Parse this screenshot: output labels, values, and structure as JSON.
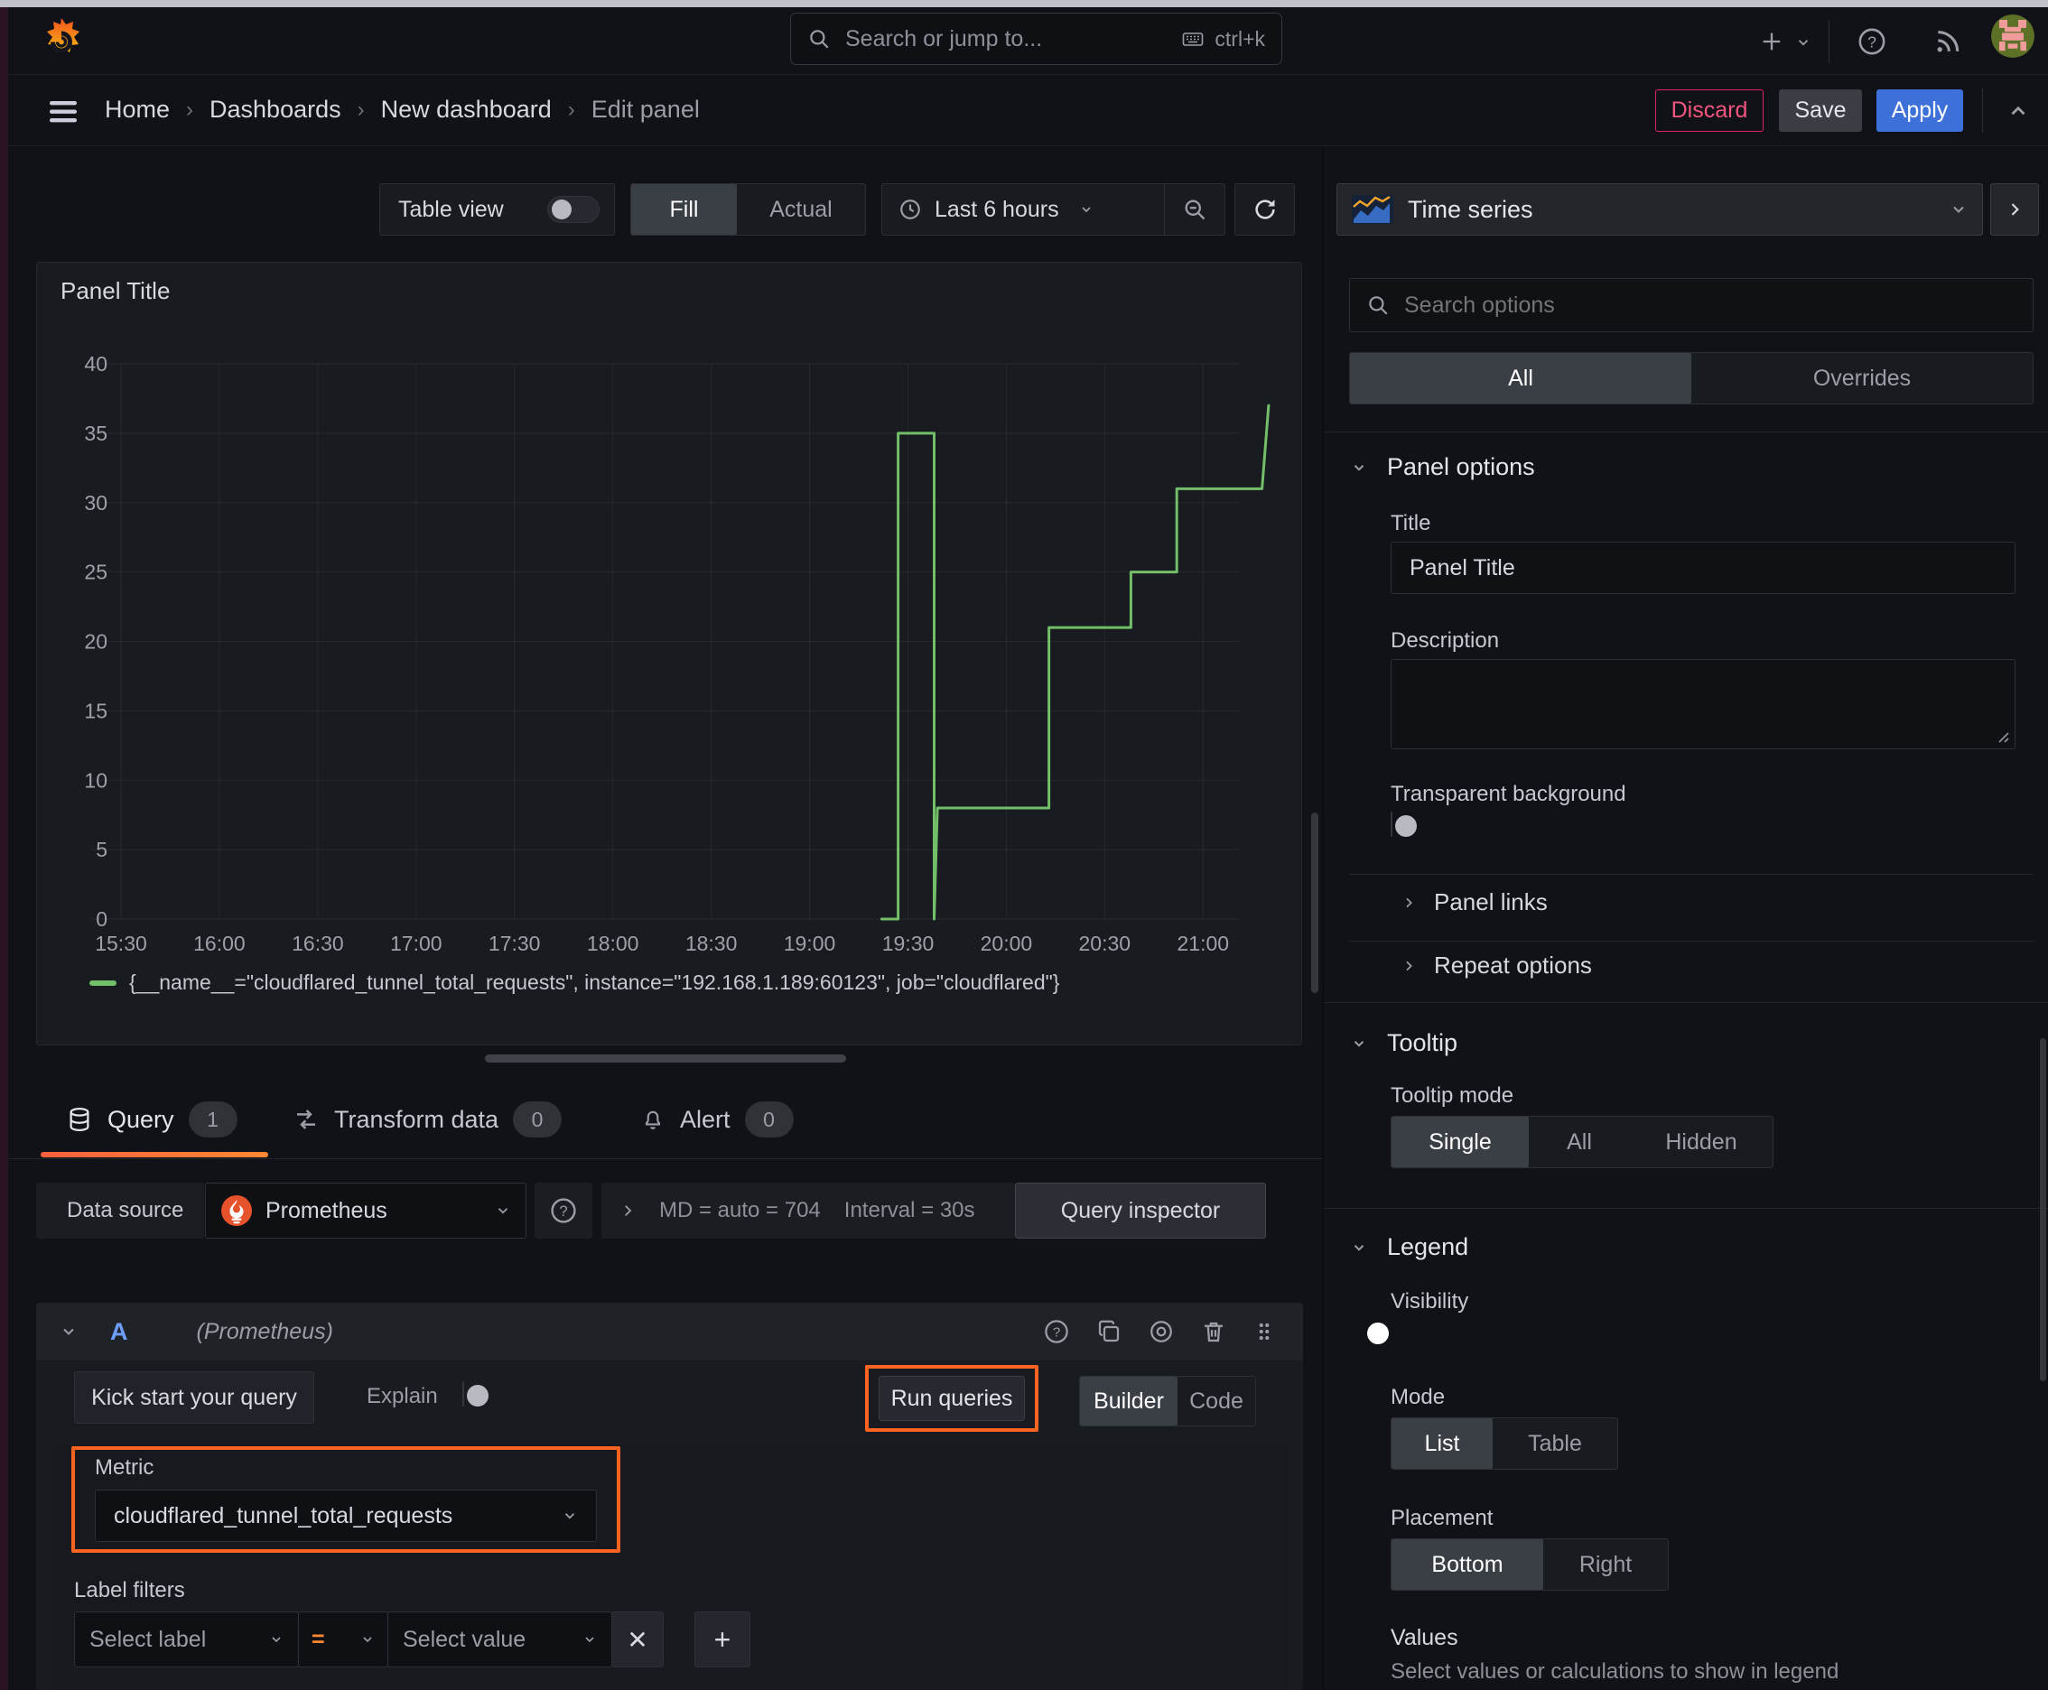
{
  "topbar": {
    "search_placeholder": "Search or jump to...",
    "shortcut_label": "ctrl+k"
  },
  "breadcrumb": {
    "items": [
      "Home",
      "Dashboards",
      "New dashboard",
      "Edit panel"
    ]
  },
  "header_actions": {
    "discard": "Discard",
    "save": "Save",
    "apply": "Apply"
  },
  "panel_toolbar": {
    "table_view_label": "Table view",
    "fill_label": "Fill",
    "actual_label": "Actual",
    "time_range_label": "Last 6 hours"
  },
  "viz_picker_label": "Time series",
  "panel": {
    "title": "Panel Title"
  },
  "chart_data": {
    "type": "line",
    "title": "Panel Title",
    "x_tick_labels": [
      "15:30",
      "16:00",
      "16:30",
      "17:00",
      "17:30",
      "18:00",
      "18:30",
      "19:00",
      "19:30",
      "20:00",
      "20:30",
      "21:00"
    ],
    "x_tick_minutes": [
      0,
      30,
      60,
      90,
      120,
      150,
      180,
      210,
      240,
      270,
      300,
      330
    ],
    "x_range_minutes": [
      0,
      352
    ],
    "y_ticks": [
      0,
      5,
      10,
      15,
      20,
      25,
      30,
      35,
      40
    ],
    "ylim": [
      0,
      40
    ],
    "grid": true,
    "legend_position": "bottom",
    "series": [
      {
        "name": "{__name__=\"cloudflared_tunnel_total_requests\", instance=\"192.168.1.189:60123\", job=\"cloudflared\"}",
        "color": "#73bf69",
        "points": [
          [
            232,
            0
          ],
          [
            237,
            0
          ],
          [
            237,
            35
          ],
          [
            248,
            35
          ],
          [
            248,
            0
          ],
          [
            249,
            8
          ],
          [
            283,
            8
          ],
          [
            283,
            21
          ],
          [
            308,
            21
          ],
          [
            308,
            25
          ],
          [
            322,
            25
          ],
          [
            322,
            31
          ],
          [
            348,
            31
          ],
          [
            350,
            37
          ]
        ]
      }
    ]
  },
  "query_tabs": [
    {
      "label": "Query",
      "count": "1"
    },
    {
      "label": "Transform data",
      "count": "0"
    },
    {
      "label": "Alert",
      "count": "0"
    }
  ],
  "datasource_bar": {
    "label": "Data source",
    "name": "Prometheus",
    "max_data_points": "MD = auto = 704",
    "interval": "Interval = 30s",
    "inspector_label": "Query inspector"
  },
  "query_editor": {
    "ref_id": "A",
    "ds_hint": "(Prometheus)",
    "kickstart_label": "Kick start your query",
    "explain_label": "Explain",
    "run_label": "Run queries",
    "builder_label": "Builder",
    "code_label": "Code",
    "metric": {
      "label": "Metric",
      "value": "cloudflared_tunnel_total_requests"
    },
    "label_filters": {
      "label": "Label filters",
      "select_label_placeholder": "Select label",
      "operator": "=",
      "select_value_placeholder": "Select value"
    }
  },
  "options_pane": {
    "search_placeholder": "Search options",
    "tabs": {
      "all": "All",
      "overrides": "Overrides"
    },
    "panel_options": {
      "header": "Panel options",
      "title_label": "Title",
      "title_value": "Panel Title",
      "description_label": "Description",
      "transparent_label": "Transparent background"
    },
    "panel_links_header": "Panel links",
    "repeat_header": "Repeat options",
    "tooltip": {
      "header": "Tooltip",
      "mode_label": "Tooltip mode",
      "modes": [
        "Single",
        "All",
        "Hidden"
      ]
    },
    "legend": {
      "header": "Legend",
      "visibility_label": "Visibility",
      "mode_label": "Mode",
      "modes": [
        "List",
        "Table"
      ],
      "placement_label": "Placement",
      "placements": [
        "Bottom",
        "Right"
      ],
      "values_label": "Values",
      "values_help": "Select values or calculations to show in legend"
    }
  },
  "colors": {
    "accent_blue": "#3d71d9",
    "series_green": "#73bf69",
    "annotation_orange": "#fb6420",
    "discard_red": "#f2557f",
    "ref_id_blue": "#6e9fff"
  }
}
